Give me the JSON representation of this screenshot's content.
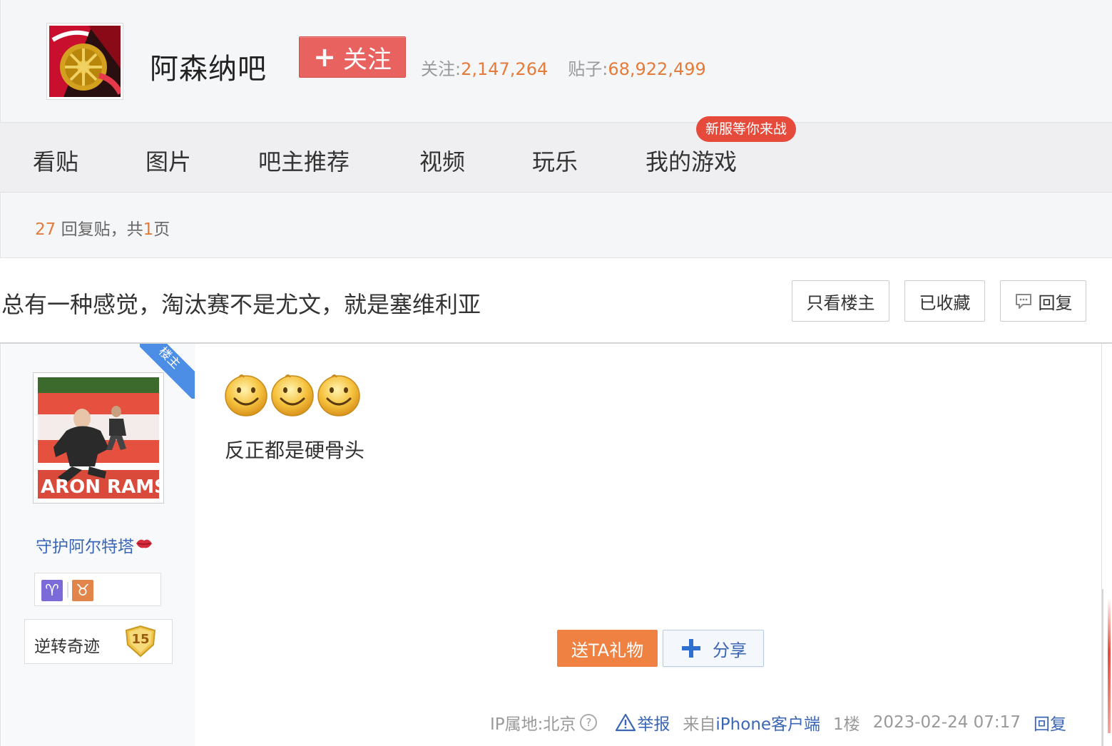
{
  "forum": {
    "name": "阿森纳吧",
    "follow_label": "关注",
    "follow_plus": "+",
    "stats": {
      "followers_label": "关注:",
      "followers": "2,147,264",
      "posts_label": "贴子:",
      "posts": "68,922,499"
    }
  },
  "nav": {
    "items": [
      {
        "label": "看贴"
      },
      {
        "label": "图片"
      },
      {
        "label": "吧主推荐"
      },
      {
        "label": "视频"
      },
      {
        "label": "玩乐"
      },
      {
        "label": "我的游戏"
      }
    ],
    "badge": "新服等你来战"
  },
  "thread_info": {
    "reply_count": "27",
    "reply_text": "回复贴，共",
    "page_count": "1",
    "page_unit": "页"
  },
  "thread": {
    "title": "总有一种感觉，淘汰赛不是尤文，就是塞维利亚",
    "only_op_label": "只看楼主",
    "favorited_label": "已收藏",
    "reply_label": "回复"
  },
  "post": {
    "op_badge": "楼主",
    "author": {
      "name": "守护阿尔特塔",
      "avatar_caption": "ARON RAMS",
      "zodiac_icons": [
        "aries-icon",
        "taurus-icon"
      ],
      "level_title": "逆转奇迹",
      "level": "15"
    },
    "emoji_count": 3,
    "content": "反正都是硬骨头",
    "gift_label": "送TA礼物",
    "share_label": "分享",
    "meta": {
      "ip": "IP属地:北京",
      "help": "?",
      "report": "举报",
      "client_prefix": "来自",
      "client_link": "iPhone客户端",
      "floor": "1楼",
      "datetime": "2023-02-24 07:17",
      "reply": "回复"
    }
  },
  "colors": {
    "accent_orange": "#e57b3a",
    "follow_red": "#e8625f",
    "link_blue": "#3a66b5",
    "badge_red": "#e64a3b",
    "op_badge_blue": "#4c8de5"
  }
}
